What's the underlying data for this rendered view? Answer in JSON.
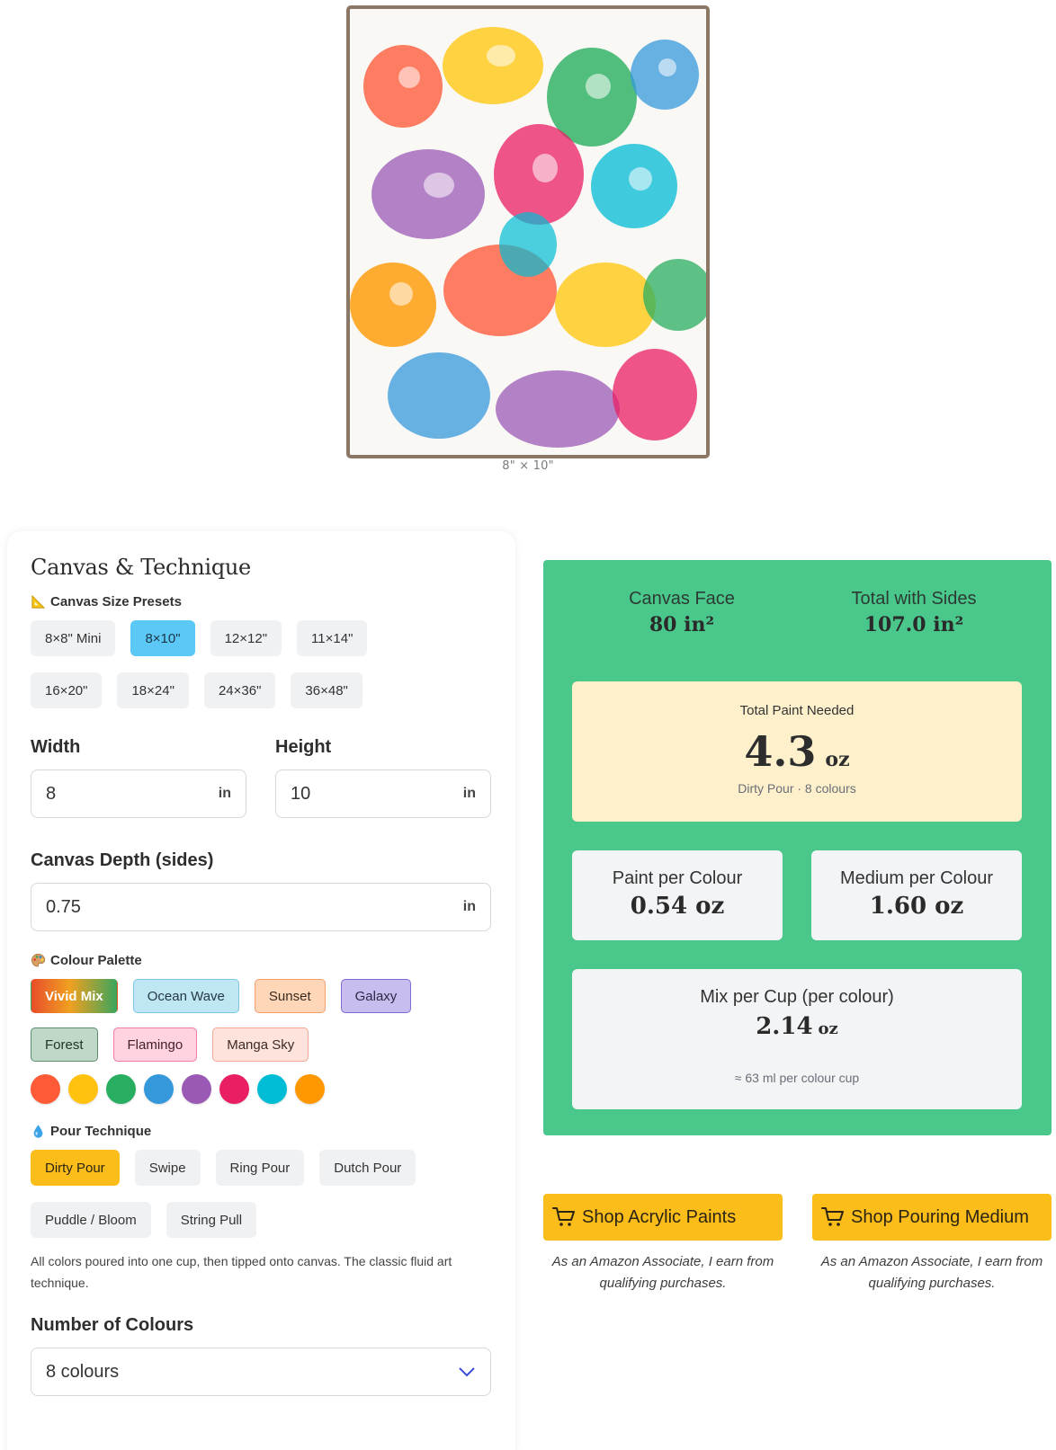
{
  "preview": {
    "dimension_label": "8\" × 10\""
  },
  "left": {
    "title": "Canvas & Technique",
    "presets_heading": "Canvas Size Presets",
    "presets": [
      "8×8\" Mini",
      "8×10\"",
      "12×12\"",
      "11×14\"",
      "16×20\"",
      "18×24\"",
      "24×36\"",
      "36×48\""
    ],
    "presets_selected": "8×10\"",
    "width_label": "Width",
    "width_value": "8",
    "width_unit": "in",
    "height_label": "Height",
    "height_value": "10",
    "height_unit": "in",
    "depth_label": "Canvas Depth (sides)",
    "depth_value": "0.75",
    "depth_unit": "in",
    "palette_heading": "Colour Palette",
    "palettes": [
      "Vivid Mix",
      "Ocean Wave",
      "Sunset",
      "Galaxy",
      "Forest",
      "Flamingo",
      "Manga Sky"
    ],
    "palette_selected": "Vivid Mix",
    "swatches": [
      "#ff5a36",
      "#ffc20e",
      "#27ae60",
      "#3498db",
      "#9b59b6",
      "#e91e63",
      "#00bcd4",
      "#ff9800"
    ],
    "technique_heading": "Pour Technique",
    "techniques": [
      "Dirty Pour",
      "Swipe",
      "Ring Pour",
      "Dutch Pour",
      "Puddle / Bloom",
      "String Pull"
    ],
    "technique_selected": "Dirty Pour",
    "technique_desc": "All colors poured into one cup, then tipped onto canvas. The classic fluid art technique.",
    "colours_label": "Number of Colours",
    "colours_value": "8 colours"
  },
  "results": {
    "face_label": "Canvas Face",
    "face_value": "80 in²",
    "sides_label": "Total with Sides",
    "sides_value": "107.0 in²",
    "total_label": "Total Paint Needed",
    "total_value": "4.3",
    "total_unit": "oz",
    "total_sub": "Dirty Pour · 8 colours",
    "paint_label": "Paint per Colour",
    "paint_value": "0.54 oz",
    "medium_label": "Medium per Colour",
    "medium_value": "1.60 oz",
    "cup_label": "Mix per Cup (per colour)",
    "cup_value": "2.14",
    "cup_unit": "oz",
    "cup_sub": "≈ 63 ml per colour cup"
  },
  "shop": {
    "paints_label": "Shop Acrylic Paints",
    "medium_label": "Shop Pouring Medium",
    "disclaimer": "As an Amazon Associate, I earn from qualifying purchases."
  },
  "colors": {
    "results_bg": "#4ac88c",
    "total_card_bg": "#fdf0cb",
    "accent_chip": "#5bc8f5",
    "technique_active": "#fbbd1a",
    "shop_button": "#fbbd1a",
    "frame": "#8b7765"
  }
}
